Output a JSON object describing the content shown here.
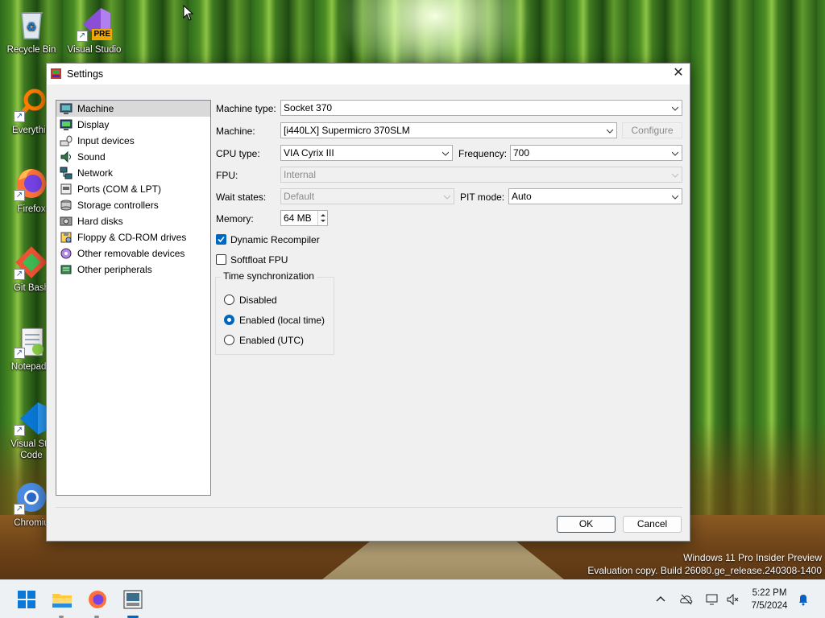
{
  "desktop": {
    "icons": [
      {
        "label": "Recycle Bin"
      },
      {
        "label": "Visual Studio",
        "badge": "PRE"
      },
      {
        "label": "Everythin"
      },
      {
        "label": "Firefox"
      },
      {
        "label": "Git Bash"
      },
      {
        "label": "Notepad+"
      },
      {
        "label_line1": "Visual Stu",
        "label_line2": "Code"
      },
      {
        "label": "Chromiu"
      }
    ]
  },
  "window": {
    "title": "Settings",
    "close_glyph": "✕",
    "sidebar": {
      "items": [
        {
          "label": "Machine",
          "icon": "machine-icon"
        },
        {
          "label": "Display",
          "icon": "display-icon"
        },
        {
          "label": "Input devices",
          "icon": "input-devices-icon"
        },
        {
          "label": "Sound",
          "icon": "sound-icon"
        },
        {
          "label": "Network",
          "icon": "network-icon"
        },
        {
          "label": "Ports (COM & LPT)",
          "icon": "ports-icon"
        },
        {
          "label": "Storage controllers",
          "icon": "storage-icon"
        },
        {
          "label": "Hard disks",
          "icon": "hard-disk-icon"
        },
        {
          "label": "Floppy & CD-ROM drives",
          "icon": "floppy-icon"
        },
        {
          "label": "Other removable devices",
          "icon": "removable-icon"
        },
        {
          "label": "Other peripherals",
          "icon": "peripherals-icon"
        }
      ],
      "selected": "Machine"
    },
    "machine": {
      "machine_type_label": "Machine type:",
      "machine_type_value": "Socket 370",
      "machine_label": "Machine:",
      "machine_value": "[i440LX] Supermicro 370SLM",
      "configure_label": "Configure",
      "cpu_type_label": "CPU type:",
      "cpu_type_value": "VIA Cyrix III",
      "frequency_label": "Frequency:",
      "frequency_value": "700",
      "fpu_label": "FPU:",
      "fpu_value": "Internal",
      "wait_states_label": "Wait states:",
      "wait_states_value": "Default",
      "pit_mode_label": "PIT mode:",
      "pit_mode_value": "Auto",
      "memory_label": "Memory:",
      "memory_value": "64 MB",
      "dynamic_recompiler_label": "Dynamic Recompiler",
      "dynamic_recompiler_checked": true,
      "softfloat_label": "Softfloat FPU",
      "softfloat_checked": false,
      "time_sync": {
        "legend": "Time synchronization",
        "options": [
          "Disabled",
          "Enabled (local time)",
          "Enabled (UTC)"
        ],
        "selected": "Enabled (local time)"
      }
    },
    "buttons": {
      "ok": "OK",
      "cancel": "Cancel"
    }
  },
  "watermark": {
    "line1": "Windows 11 Pro Insider Preview",
    "line2": "Evaluation copy. Build 26080.ge_release.240308-1400"
  },
  "taskbar": {
    "apps": [
      "start-icon",
      "file-explorer-icon",
      "firefox-icon",
      "86box-icon"
    ],
    "tray": {
      "time": "5:22 PM",
      "date": "7/5/2024"
    }
  },
  "colors": {
    "accent": "#0067c0",
    "selected_sidebar": "#d9d9d9",
    "window_bg": "#f0f0f0"
  }
}
